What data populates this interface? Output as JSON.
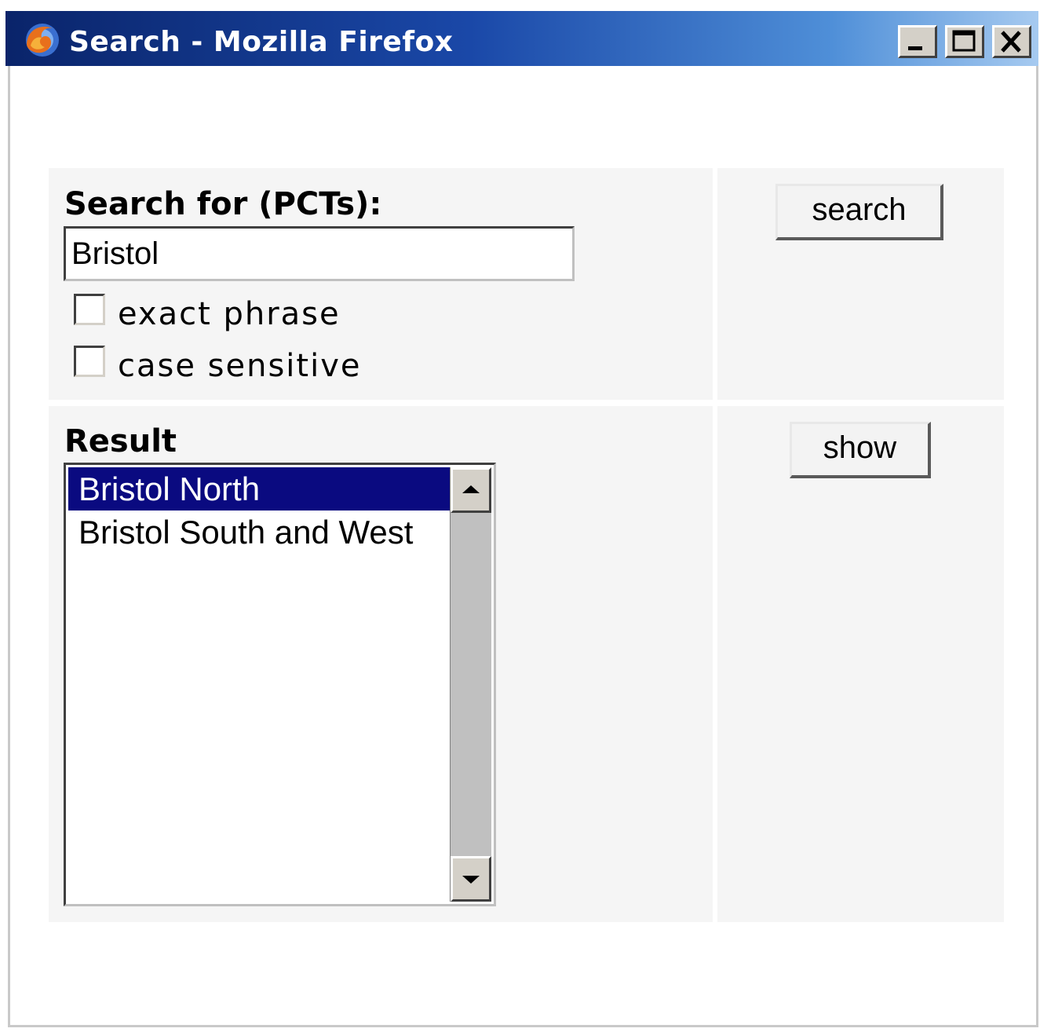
{
  "window": {
    "title": "Search - Mozilla Firefox",
    "controls": [
      "minimize",
      "maximize",
      "close"
    ]
  },
  "search": {
    "label": "Search for (PCTs):",
    "value": "Bristol",
    "options": [
      {
        "label": "exact phrase",
        "checked": false
      },
      {
        "label": "case sensitive",
        "checked": false
      }
    ],
    "button_label": "search"
  },
  "result": {
    "label": "Result",
    "items": [
      {
        "label": "Bristol North",
        "selected": true
      },
      {
        "label": "Bristol South and West",
        "selected": false
      }
    ],
    "button_label": "show"
  },
  "colors": {
    "selection": "#0a0a80",
    "titlebar_start": "#0a246a",
    "titlebar_end": "#a6caf0",
    "panel": "#f5f5f5"
  }
}
